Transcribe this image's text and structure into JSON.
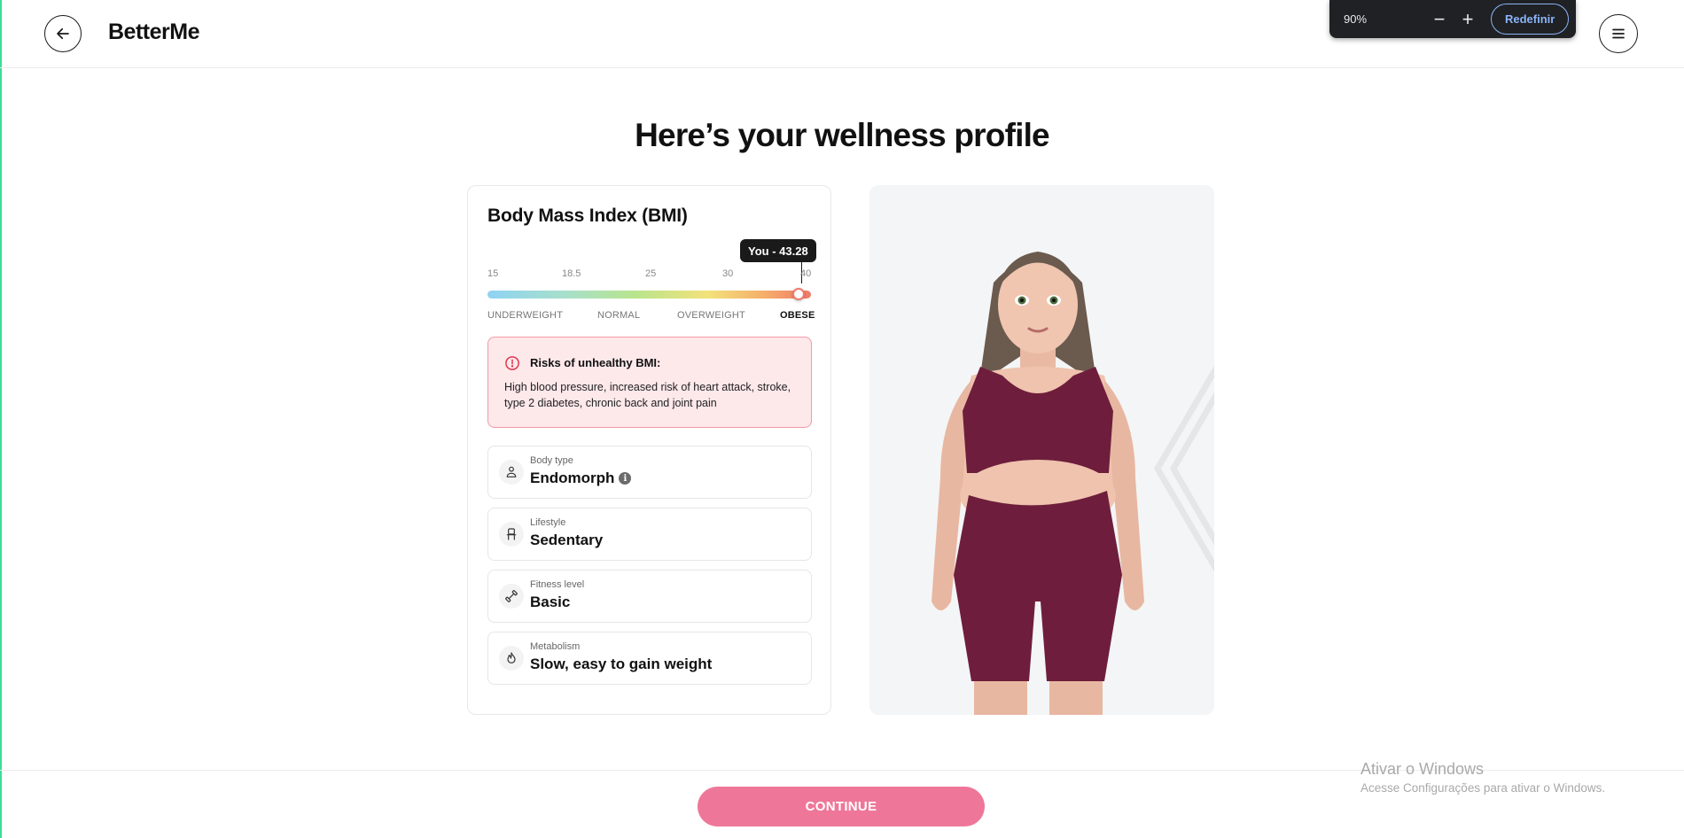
{
  "header": {
    "logo": "BetterMe"
  },
  "zoom": {
    "level": "90%",
    "minus": "−",
    "plus": "+",
    "reset_label": "Redefinir"
  },
  "page_title": "Here’s your wellness profile",
  "bmi": {
    "title": "Body Mass Index (BMI)",
    "tooltip": "You - 43.28",
    "value": 43.28,
    "scale": [
      "15",
      "18.5",
      "25",
      "30",
      "40"
    ],
    "categories": [
      "UNDERWEIGHT",
      "NORMAL",
      "OVERWEIGHT",
      "OBESE"
    ],
    "active_category": "OBESE"
  },
  "risk": {
    "title": "Risks of unhealthy BMI:",
    "text": "High blood pressure, increased risk of heart attack, stroke, type 2 diabetes, chronic back and joint pain"
  },
  "attributes": [
    {
      "label": "Body type",
      "value": "Endomorph",
      "icon": "body-icon"
    },
    {
      "label": "Lifestyle",
      "value": "Sedentary",
      "icon": "chair-icon"
    },
    {
      "label": "Fitness level",
      "value": "Basic",
      "icon": "dumbbell-icon"
    },
    {
      "label": "Metabolism",
      "value": "Slow, easy to gain weight",
      "icon": "flame-icon"
    }
  ],
  "cta": {
    "continue_label": "CONTINUE"
  },
  "watermark": {
    "title": "Ativar o Windows",
    "subtitle": "Acesse Configurações para ativar o Windows."
  },
  "colors": {
    "accent": "#ee7799",
    "risk_bg": "#fde8ea",
    "risk_border": "#f39aa6",
    "outfit": "#6e1e3c"
  }
}
